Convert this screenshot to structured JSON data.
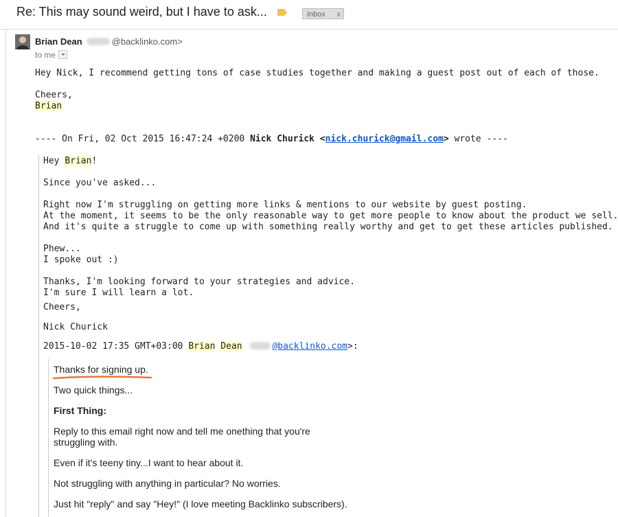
{
  "header": {
    "subject": "Re: This may sound weird, but I have to ask...",
    "label": "Inbox",
    "label_close": "x",
    "label_color": "#f2c14e"
  },
  "message": {
    "sender_name": "Brian Dean",
    "sender_email": "@backlinko.com>",
    "to_label": "to me",
    "greeting": "Hey Nick, I recommend getting tons of case studies together and making a guest post out of each of those.",
    "signoff": "Cheers,",
    "signature": "Brian"
  },
  "quoted_header": {
    "prefix": "---- On Fri, 02 Oct 2015 16:47:24 +0200 ",
    "name": "Nick Churick",
    "open": " <",
    "email": "nick.churick@gmail.com",
    "close": ">",
    "suffix": " wrote ----"
  },
  "quote1": {
    "hey": "Hey ",
    "hey_name": "Brian",
    "hey_end": "!",
    "asked": "Since you've asked...",
    "p1": "Right now I'm struggling on getting more links & mentions to our website by guest posting.",
    "p2": "At the moment, it seems to be the only reasonable way to get more people to know about the product we sell.",
    "p3": "And it's quite a struggle to come up with something really worthy and get to get these articles published.",
    "phew": "Phew...",
    "spoke": "I spoke out :)",
    "thanks": "Thanks, I'm looking forward to your strategies and advice.",
    "learn": "I'm sure I will learn a lot.",
    "cheers": "Cheers,",
    "name": "Nick Churick",
    "attrib_date": "2015-10-02 17:35 GMT+03:00 ",
    "attrib_first": "Brian",
    "attrib_last": "Dean",
    "attrib_email": "@backlinko.com",
    "attrib_end": ">:"
  },
  "quote2": {
    "l1": "Thanks for signing up.",
    "l2": "Two quick things...",
    "l3": "First Thing:",
    "l4a": "Reply to this email right now and tell me onething that you're",
    "l4b": "struggling with.",
    "l5": "Even if it's teeny tiny...I want to hear about it.",
    "l6": "Not struggling with anything in particular? No worries.",
    "l7": "Just hit \"reply\" and say \"Hey!\" (I love meeting Backlinko subscribers)."
  },
  "colors": {
    "highlight": "#ffffcc",
    "link": "#1155cc",
    "annotation_underline": "#e07a3a"
  }
}
